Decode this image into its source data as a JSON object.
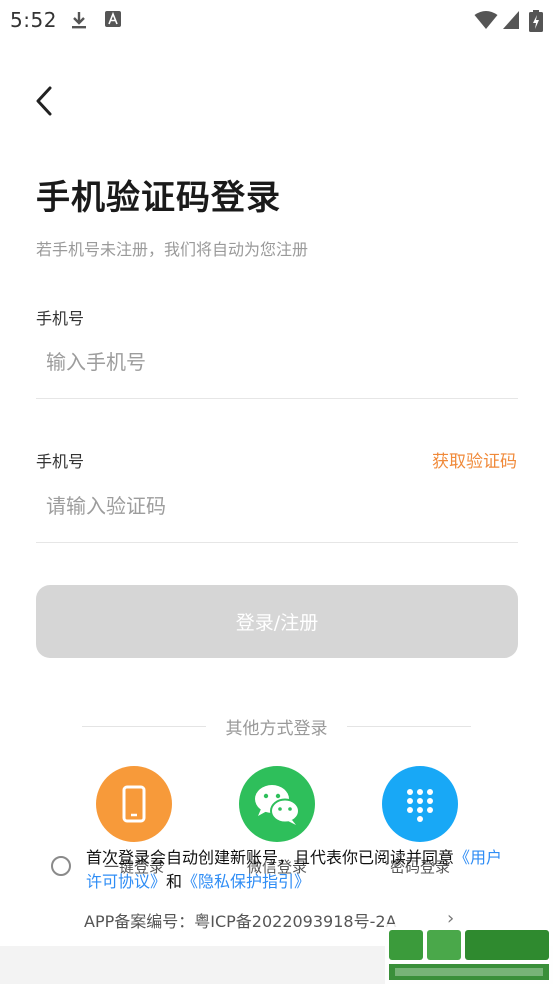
{
  "status_bar": {
    "time": "5:52",
    "icons": [
      "download-icon",
      "text-a-icon",
      "wifi-icon",
      "signal-icon",
      "battery-charging-icon"
    ]
  },
  "nav": {
    "back_icon": "chevron-left-icon"
  },
  "header": {
    "title": "手机验证码登录",
    "subtitle": "若手机号未注册，我们将自动为您注册"
  },
  "form": {
    "phone_label": "手机号",
    "phone_placeholder": "输入手机号",
    "code_label": "手机号",
    "get_code": "获取验证码",
    "code_placeholder": "请输入验证码",
    "submit": "登录/注册"
  },
  "other_login": {
    "title": "其他方式登录",
    "methods": [
      {
        "label": "一键登录",
        "icon": "phone-icon",
        "color": "#f79a3a"
      },
      {
        "label": "微信登录",
        "icon": "wechat-icon",
        "color": "#2ebf5b"
      },
      {
        "label": "密码登录",
        "icon": "keypad-icon",
        "color": "#18a8f6"
      }
    ]
  },
  "agreement": {
    "text_before": "首次登录会自动创建新账号，且代表你已阅读并同意",
    "user_agreement": "《用户许可协议》",
    "and": "和",
    "privacy": "《隐私保护指引》"
  },
  "footer": {
    "icp": "APP备案编号：粤ICP备2022093918号-2A"
  },
  "colors": {
    "accent_orange": "#f08a3a",
    "link_blue": "#2f8df5",
    "button_disabled": "#d6d6d6"
  }
}
